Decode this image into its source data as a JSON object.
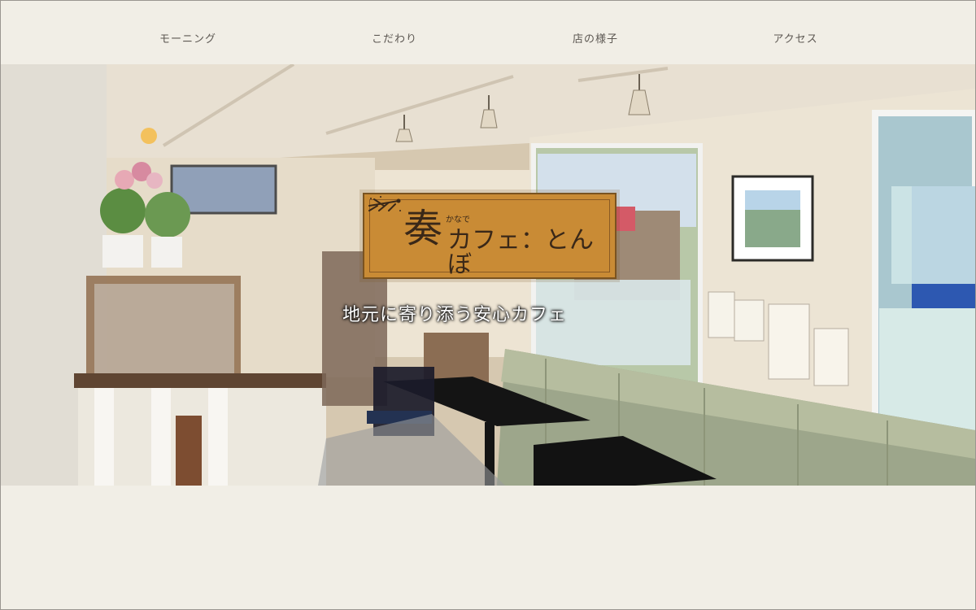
{
  "nav": {
    "items": [
      {
        "label": "モーニング"
      },
      {
        "label": "こだわり"
      },
      {
        "label": "店の様子"
      },
      {
        "label": "アクセス"
      }
    ]
  },
  "hero": {
    "image_description": "cafe interior with counter, windows and bench seating",
    "logo": {
      "kanji": "奏",
      "ruby": "かなで",
      "text": "カフェ：とんぼ",
      "color_bg": "#c98b35",
      "color_text": "#3a2818"
    },
    "tagline": "地元に寄り添う安心カフェ"
  },
  "colors": {
    "page_bg": "#f1eee6",
    "nav_text": "#5d5853"
  }
}
